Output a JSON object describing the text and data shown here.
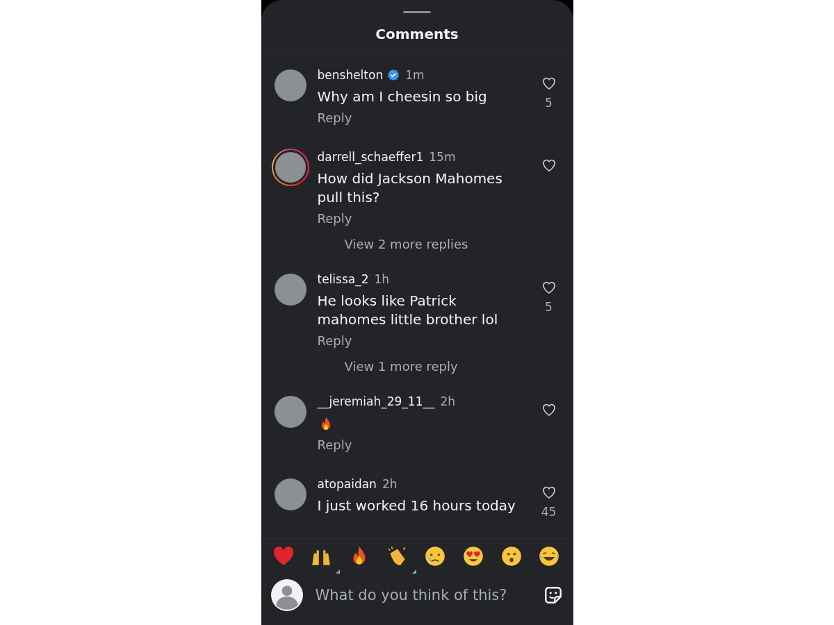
{
  "sheet": {
    "title": "Comments"
  },
  "comments": [
    {
      "username": "benshelton",
      "verified": true,
      "story_ring": false,
      "time": "1m",
      "body": {
        "kind": "text",
        "text": "Why am I cheesin so big"
      },
      "reply": "Reply",
      "likes": "5"
    },
    {
      "username": "darrell_schaeffer1",
      "verified": false,
      "story_ring": true,
      "time": "15m",
      "body": {
        "kind": "text",
        "text": "How did Jackson Mahomes pull this?"
      },
      "reply": "Reply",
      "more_replies": "View 2 more replies"
    },
    {
      "username": "telissa_2",
      "verified": false,
      "story_ring": false,
      "time": "1h",
      "body": {
        "kind": "text",
        "text": "He looks like Patrick mahomes little brother lol"
      },
      "reply": "Reply",
      "likes": "5",
      "more_replies": "View 1 more reply"
    },
    {
      "username": "__jeremiah_29_11__",
      "verified": false,
      "story_ring": false,
      "time": "2h",
      "body": {
        "kind": "fire"
      },
      "reply": "Reply"
    },
    {
      "username": "atopaidan",
      "verified": false,
      "story_ring": false,
      "time": "2h",
      "body": {
        "kind": "text",
        "text": "I just worked 16 hours today"
      },
      "likes": "45"
    }
  ],
  "reactions": [
    {
      "kind": "heart",
      "has_variants": false
    },
    {
      "kind": "raised-hands",
      "has_variants": true
    },
    {
      "kind": "fire",
      "has_variants": false
    },
    {
      "kind": "clap",
      "has_variants": true
    },
    {
      "kind": "sad",
      "has_variants": false
    },
    {
      "kind": "heart-eyes",
      "has_variants": false
    },
    {
      "kind": "surprised",
      "has_variants": false
    },
    {
      "kind": "laughing",
      "has_variants": false
    }
  ],
  "composer": {
    "placeholder": "What do you think of this?"
  }
}
